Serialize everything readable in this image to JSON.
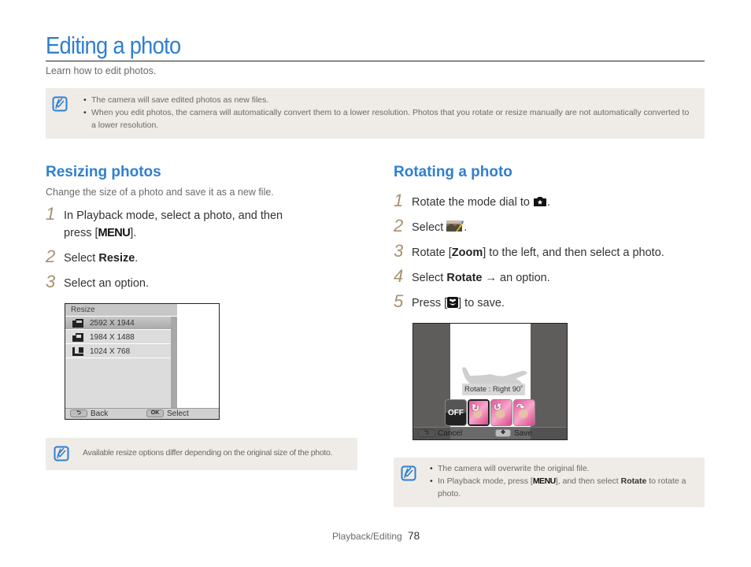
{
  "header": {
    "title": "Editing a photo",
    "subtitle": "Learn how to edit photos."
  },
  "top_note": {
    "icon": "note-pencil-icon",
    "items": [
      "The camera will save edited photos as new files.",
      "When you edit photos, the camera will automatically convert them to a lower resolution. Photos that you rotate or resize manually are not automatically converted to a lower resolution."
    ]
  },
  "resizing": {
    "title": "Resizing photos",
    "description": "Change the size of a photo and save it as a new file.",
    "steps": [
      {
        "num": "1",
        "text_before": "In Playback mode, select a photo, and then press [",
        "key": "MENU",
        "text_after": "]."
      },
      {
        "num": "2",
        "text_before": "Select ",
        "bold": "Resize",
        "text_after": "."
      },
      {
        "num": "3",
        "text": "Select an option."
      }
    ],
    "screen": {
      "header": "Resize",
      "options": [
        {
          "label": "2592 X 1944",
          "icon": "resize-5m-icon",
          "selected": true
        },
        {
          "label": "1984 X 1488",
          "icon": "resize-3m-icon",
          "selected": false
        },
        {
          "label": "1024 X 768",
          "icon": "resize-1m-icon",
          "selected": false
        }
      ],
      "footer": {
        "back_key": "back-arrow-icon",
        "back_label": "Back",
        "select_key": "OK",
        "select_label": "Select"
      }
    },
    "note": {
      "icon": "note-pencil-icon",
      "text": "Available resize options differ depending on the original size of the photo."
    }
  },
  "rotating": {
    "title": "Rotating a photo",
    "steps": [
      {
        "num": "1",
        "text_before": "Rotate the mode dial to ",
        "icon": "camera-star-icon",
        "text_after": "."
      },
      {
        "num": "2",
        "text_before": "Select ",
        "icon": "photo-edit-icon",
        "text_after": "."
      },
      {
        "num": "3",
        "text_before": "Rotate [",
        "bold": "Zoom",
        "text_after": "] to the left, and then select a photo."
      },
      {
        "num": "4",
        "text_before": "Select ",
        "bold": "Rotate",
        "arrow": " → ",
        "text_after": "an option."
      },
      {
        "num": "5",
        "text_before": "Press [",
        "icon": "macro-flower-icon",
        "text_after": "] to save."
      }
    ],
    "screen": {
      "label": "Rotate : Right 90˚",
      "thumbs": [
        {
          "name": "off",
          "label": "OFF",
          "selected": false
        },
        {
          "name": "right-90",
          "arrow": "↻",
          "selected": true
        },
        {
          "name": "left-90",
          "arrow": "↺",
          "selected": false
        },
        {
          "name": "180",
          "arrow": "↷",
          "selected": false
        }
      ],
      "footer": {
        "cancel_key": "back-arrow-icon",
        "cancel_label": "Cancel",
        "save_key": "dpad-icon",
        "save_label": "Save"
      }
    },
    "note": {
      "icon": "note-pencil-icon",
      "item1": "The camera will overwrite the original file.",
      "item2_before": "In Playback mode, press [",
      "item2_key": "MENU",
      "item2_mid": "], and then select ",
      "item2_bold": "Rotate",
      "item2_after": " to rotate a photo."
    }
  },
  "footer": {
    "section": "Playback/Editing",
    "page": "78"
  },
  "colors": {
    "accent_blue": "#2f7fd0",
    "step_number": "#a8906e",
    "note_bg": "#efebe6"
  }
}
